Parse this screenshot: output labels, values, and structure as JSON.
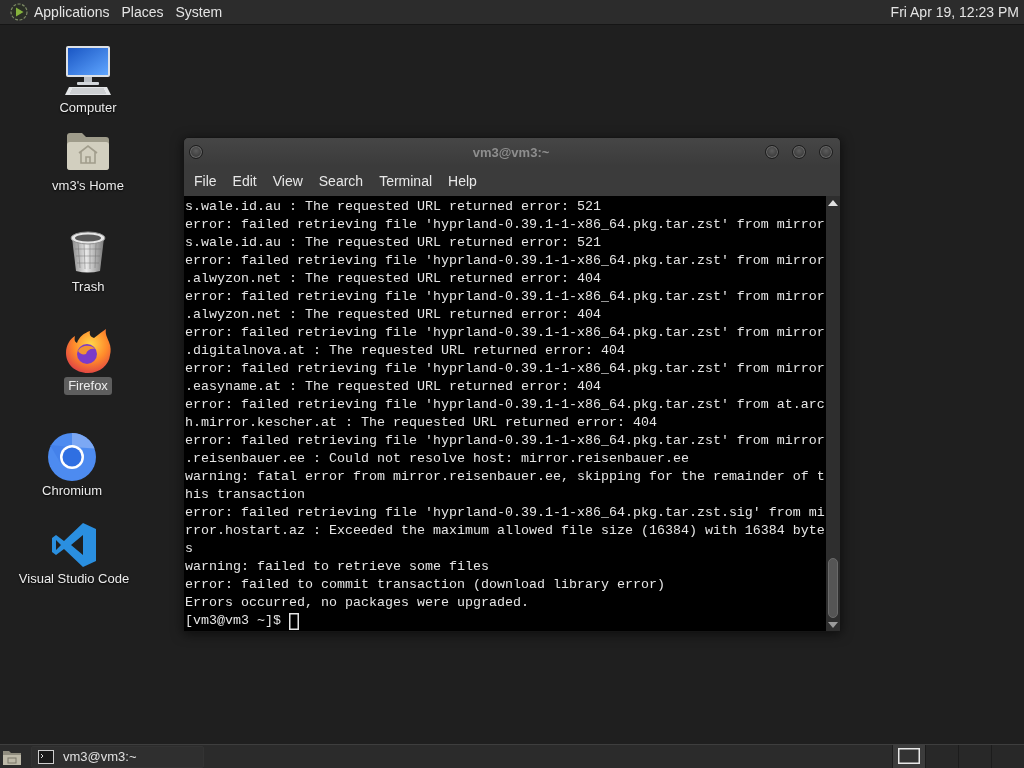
{
  "top_panel": {
    "menus": [
      "Applications",
      "Places",
      "System"
    ],
    "clock": "Fri Apr 19, 12:23 PM"
  },
  "desktop_icons": [
    {
      "label": "Computer",
      "kind": "computer",
      "selected": false
    },
    {
      "label": "vm3's Home",
      "kind": "home",
      "selected": false
    },
    {
      "label": "Trash",
      "kind": "trash",
      "selected": false
    },
    {
      "label": "Firefox",
      "kind": "firefox",
      "selected": true
    },
    {
      "label": "Chromium",
      "kind": "chromium",
      "selected": false
    },
    {
      "label": "Visual Studio Code",
      "kind": "vscode",
      "selected": false
    }
  ],
  "terminal_window": {
    "title": "vm3@vm3:~",
    "menu": [
      "File",
      "Edit",
      "View",
      "Search",
      "Terminal",
      "Help"
    ],
    "lines": [
      "s.wale.id.au : The requested URL returned error: 521",
      "error: failed retrieving file 'hyprland-0.39.1-1-x86_64.pkg.tar.zst' from mirror",
      "s.wale.id.au : The requested URL returned error: 521",
      "error: failed retrieving file 'hyprland-0.39.1-1-x86_64.pkg.tar.zst' from mirror",
      ".alwyzon.net : The requested URL returned error: 404",
      "error: failed retrieving file 'hyprland-0.39.1-1-x86_64.pkg.tar.zst' from mirror",
      ".alwyzon.net : The requested URL returned error: 404",
      "error: failed retrieving file 'hyprland-0.39.1-1-x86_64.pkg.tar.zst' from mirror",
      ".digitalnova.at : The requested URL returned error: 404",
      "error: failed retrieving file 'hyprland-0.39.1-1-x86_64.pkg.tar.zst' from mirror",
      ".easyname.at : The requested URL returned error: 404",
      "error: failed retrieving file 'hyprland-0.39.1-1-x86_64.pkg.tar.zst' from at.arc",
      "h.mirror.kescher.at : The requested URL returned error: 404",
      "error: failed retrieving file 'hyprland-0.39.1-1-x86_64.pkg.tar.zst' from mirror",
      ".reisenbauer.ee : Could not resolve host: mirror.reisenbauer.ee",
      "warning: fatal error from mirror.reisenbauer.ee, skipping for the remainder of t",
      "his transaction",
      "error: failed retrieving file 'hyprland-0.39.1-1-x86_64.pkg.tar.zst.sig' from mi",
      "rror.hostart.az : Exceeded the maximum allowed file size (16384) with 16384 byte",
      "s",
      "warning: failed to retrieve some files",
      "error: failed to commit transaction (download library error)",
      "Errors occurred, no packages were upgraded."
    ],
    "prompt": "[vm3@vm3 ~]$"
  },
  "taskbar": {
    "tasks": [
      {
        "label": "vm3@vm3:~",
        "selected": false
      }
    ],
    "workspaces": [
      {
        "selected": true,
        "has_window": true
      },
      {
        "selected": false,
        "has_window": false
      },
      {
        "selected": false,
        "has_window": false
      },
      {
        "selected": false,
        "has_window": false
      }
    ]
  }
}
